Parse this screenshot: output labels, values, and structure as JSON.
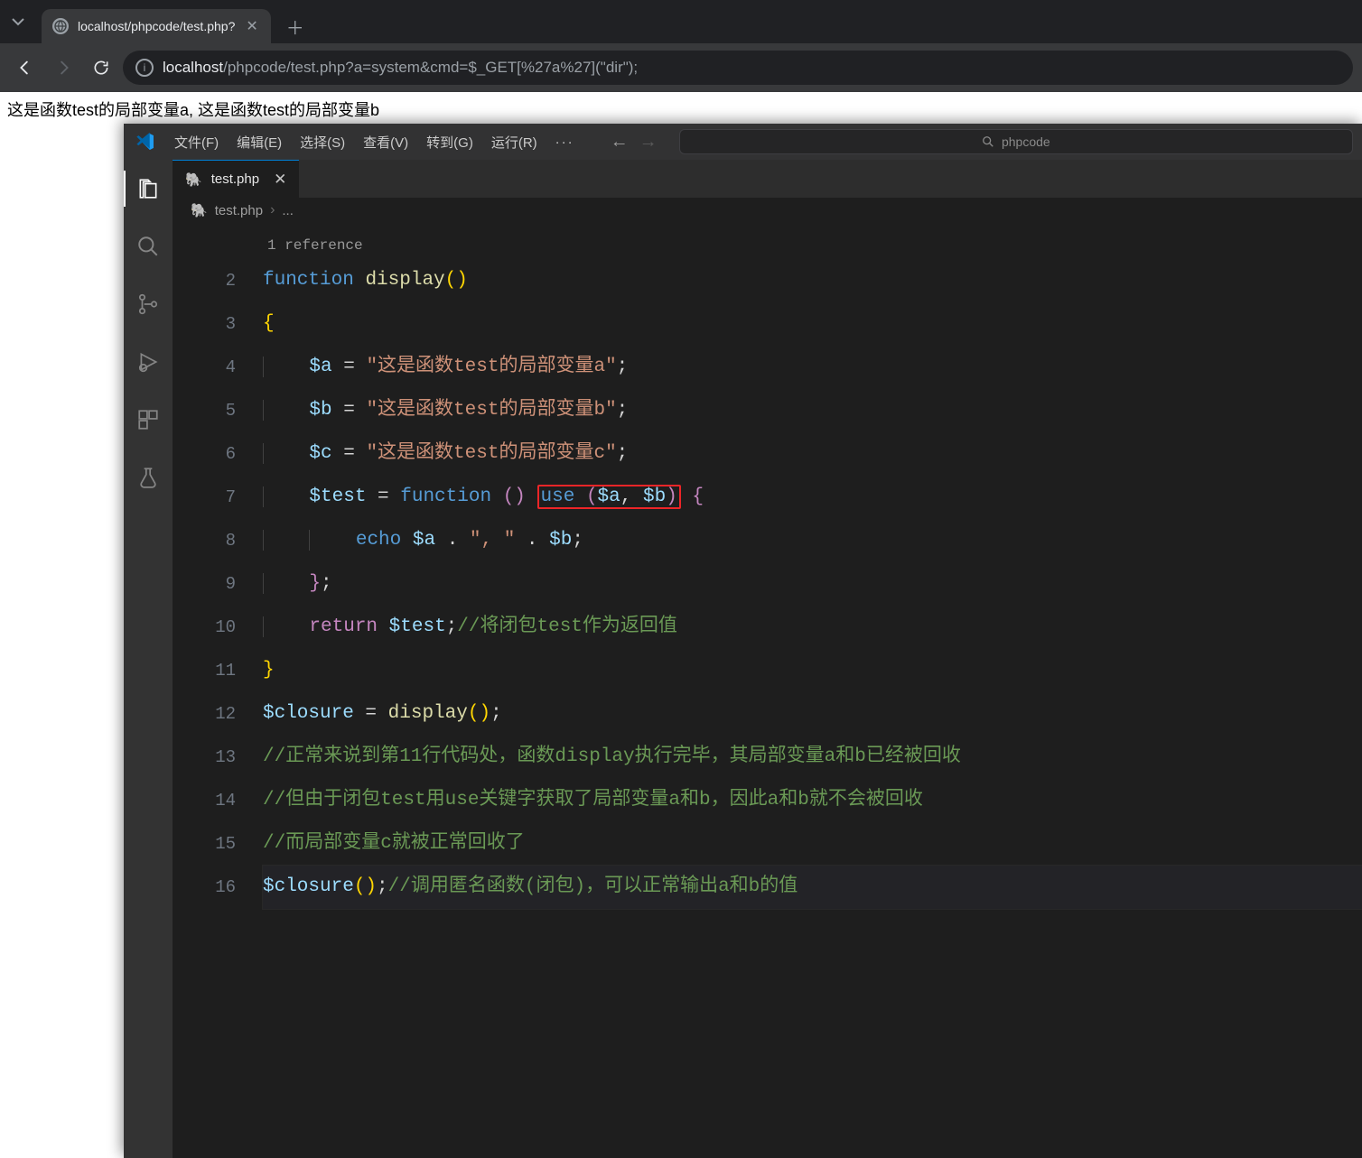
{
  "browser": {
    "tab_title": "localhost/phpcode/test.php?",
    "url_host": "localhost",
    "url_rest": "/phpcode/test.php?a=system&cmd=$_GET[%27a%27](\"dir\");"
  },
  "page_output": "这是函数test的局部变量a, 这是函数test的局部变量b",
  "vscode": {
    "menu": {
      "file": "文件(F)",
      "edit": "编辑(E)",
      "select": "选择(S)",
      "view": "查看(V)",
      "goto": "转到(G)",
      "run": "运行(R)",
      "more": "···"
    },
    "search_placeholder": "phpcode",
    "tab": {
      "filename": "test.php"
    },
    "breadcrumb": {
      "file": "test.php",
      "more": "..."
    },
    "codelens": "1 reference",
    "lines": {
      "l2_function": "function",
      "l2_name": "display",
      "l4_var": "$a",
      "l4_str": "\"这是函数test的局部变量a\"",
      "l5_var": "$b",
      "l5_str": "\"这是函数test的局部变量b\"",
      "l6_var": "$c",
      "l6_str": "\"这是函数test的局部变量c\"",
      "l7_var": "$test",
      "l7_function": "function",
      "l7_use": "use",
      "l7_a": "$a",
      "l7_b": "$b",
      "l8_echo": "echo",
      "l8_a": "$a",
      "l8_sep": "\", \"",
      "l8_b": "$b",
      "l10_return": "return",
      "l10_var": "$test",
      "l10_cmt": "//将闭包test作为返回值",
      "l12_var": "$closure",
      "l12_fn": "display",
      "l13_cmt": "//正常来说到第11行代码处，函数display执行完毕，其局部变量a和b已经被回收",
      "l14_cmt": "//但由于闭包test用use关键字获取了局部变量a和b，因此a和b就不会被回收",
      "l15_cmt": "//而局部变量c就被正常回收了",
      "l16_var": "$closure",
      "l16_cmt": "//调用匿名函数(闭包)，可以正常输出a和b的值"
    },
    "line_numbers": [
      "2",
      "3",
      "4",
      "5",
      "6",
      "7",
      "8",
      "9",
      "10",
      "11",
      "12",
      "13",
      "14",
      "15",
      "16"
    ]
  }
}
